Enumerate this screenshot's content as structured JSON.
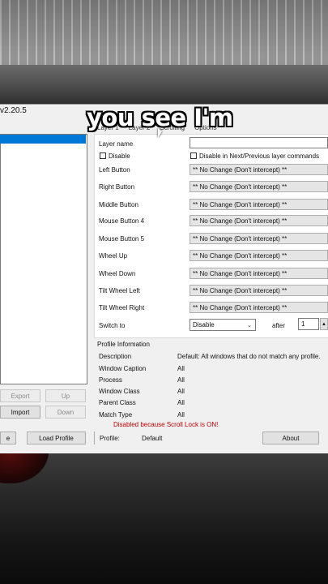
{
  "window_title_fragment": "v2.20.5",
  "caption": "you see I'm",
  "tabs": [
    "Layer 1",
    "Layer 2",
    "Scrolling",
    "Options"
  ],
  "layer": {
    "name_label": "Layer name",
    "disable_label": "Disable",
    "disable_next_prev_label": "Disable in Next/Previous layer commands"
  },
  "mappings": [
    {
      "label": "Left Button",
      "value": "** No Change (Don't intercept) **"
    },
    {
      "label": "Right Button",
      "value": "** No Change (Don't intercept) **"
    },
    {
      "label": "Middle Button",
      "value": "** No Change (Don't intercept) **"
    },
    {
      "label": "Mouse Button 4",
      "value": "** No Change (Don't intercept) **"
    },
    {
      "label": "Mouse Button 5",
      "value": "** No Change (Don't intercept) **"
    },
    {
      "label": "Wheel Up",
      "value": "** No Change (Don't intercept) **"
    },
    {
      "label": "Wheel Down",
      "value": "** No Change (Don't intercept) **"
    },
    {
      "label": "Tilt Wheel Left",
      "value": "** No Change (Don't intercept) **"
    },
    {
      "label": "Tilt Wheel Right",
      "value": "** No Change (Don't intercept) **"
    }
  ],
  "switch_to": {
    "label": "Switch to",
    "value": "Disable",
    "after_label": "after",
    "after_value": "1"
  },
  "profile_info": {
    "heading": "Profile Information",
    "rows": [
      {
        "label": "Description",
        "value": "Default: All windows that do not match any profile."
      },
      {
        "label": "Window Caption",
        "value": "All"
      },
      {
        "label": "Process",
        "value": "All"
      },
      {
        "label": "Window Class",
        "value": "All"
      },
      {
        "label": "Parent Class",
        "value": "All"
      },
      {
        "label": "Match Type",
        "value": "All"
      }
    ]
  },
  "status_message": "Disabled because Scroll Lock is ON!",
  "left_buttons": {
    "export": "Export",
    "up": "Up",
    "import": "Import",
    "down": "Down"
  },
  "bottom": {
    "save_fragment": "e",
    "load_profile": "Load Profile",
    "profile_label": "Profile:",
    "profile_value": "Default",
    "about": "About"
  }
}
